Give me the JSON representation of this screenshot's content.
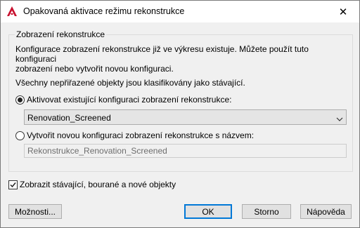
{
  "window": {
    "title": "Opakovaná aktivace režimu rekonstrukce",
    "close_symbol": "✕",
    "app_icon": "autocad-icon",
    "accent_color": "#c8102e"
  },
  "group": {
    "legend": "Zobrazení rekonstrukce",
    "info_line1": "Konfigurace zobrazení rekonstrukce již ve výkresu existuje. Můžete použít tuto konfiguraci",
    "info_line2": "zobrazení nebo vytvořit novou konfiguraci.",
    "static_text": "Všechny nepřiřazené objekty jsou klasifikovány jako stávající.",
    "option_existing": {
      "label": "Aktivovat existující konfiguraci zobrazení rekonstrukce:",
      "selected": true
    },
    "existing_select": {
      "value": "Renovation_Screened"
    },
    "option_new": {
      "label": "Vytvořit novou konfiguraci zobrazení rekonstrukce s názvem:",
      "selected": false
    },
    "new_name_input": {
      "value": "Rekonstrukce_Renovation_Screened"
    }
  },
  "show_objects_checkbox": {
    "label": "Zobrazit stávající, bourané a nové objekty",
    "checked": true
  },
  "buttons": {
    "options": "Možnosti...",
    "ok": "OK",
    "cancel": "Storno",
    "help": "Nápověda"
  }
}
